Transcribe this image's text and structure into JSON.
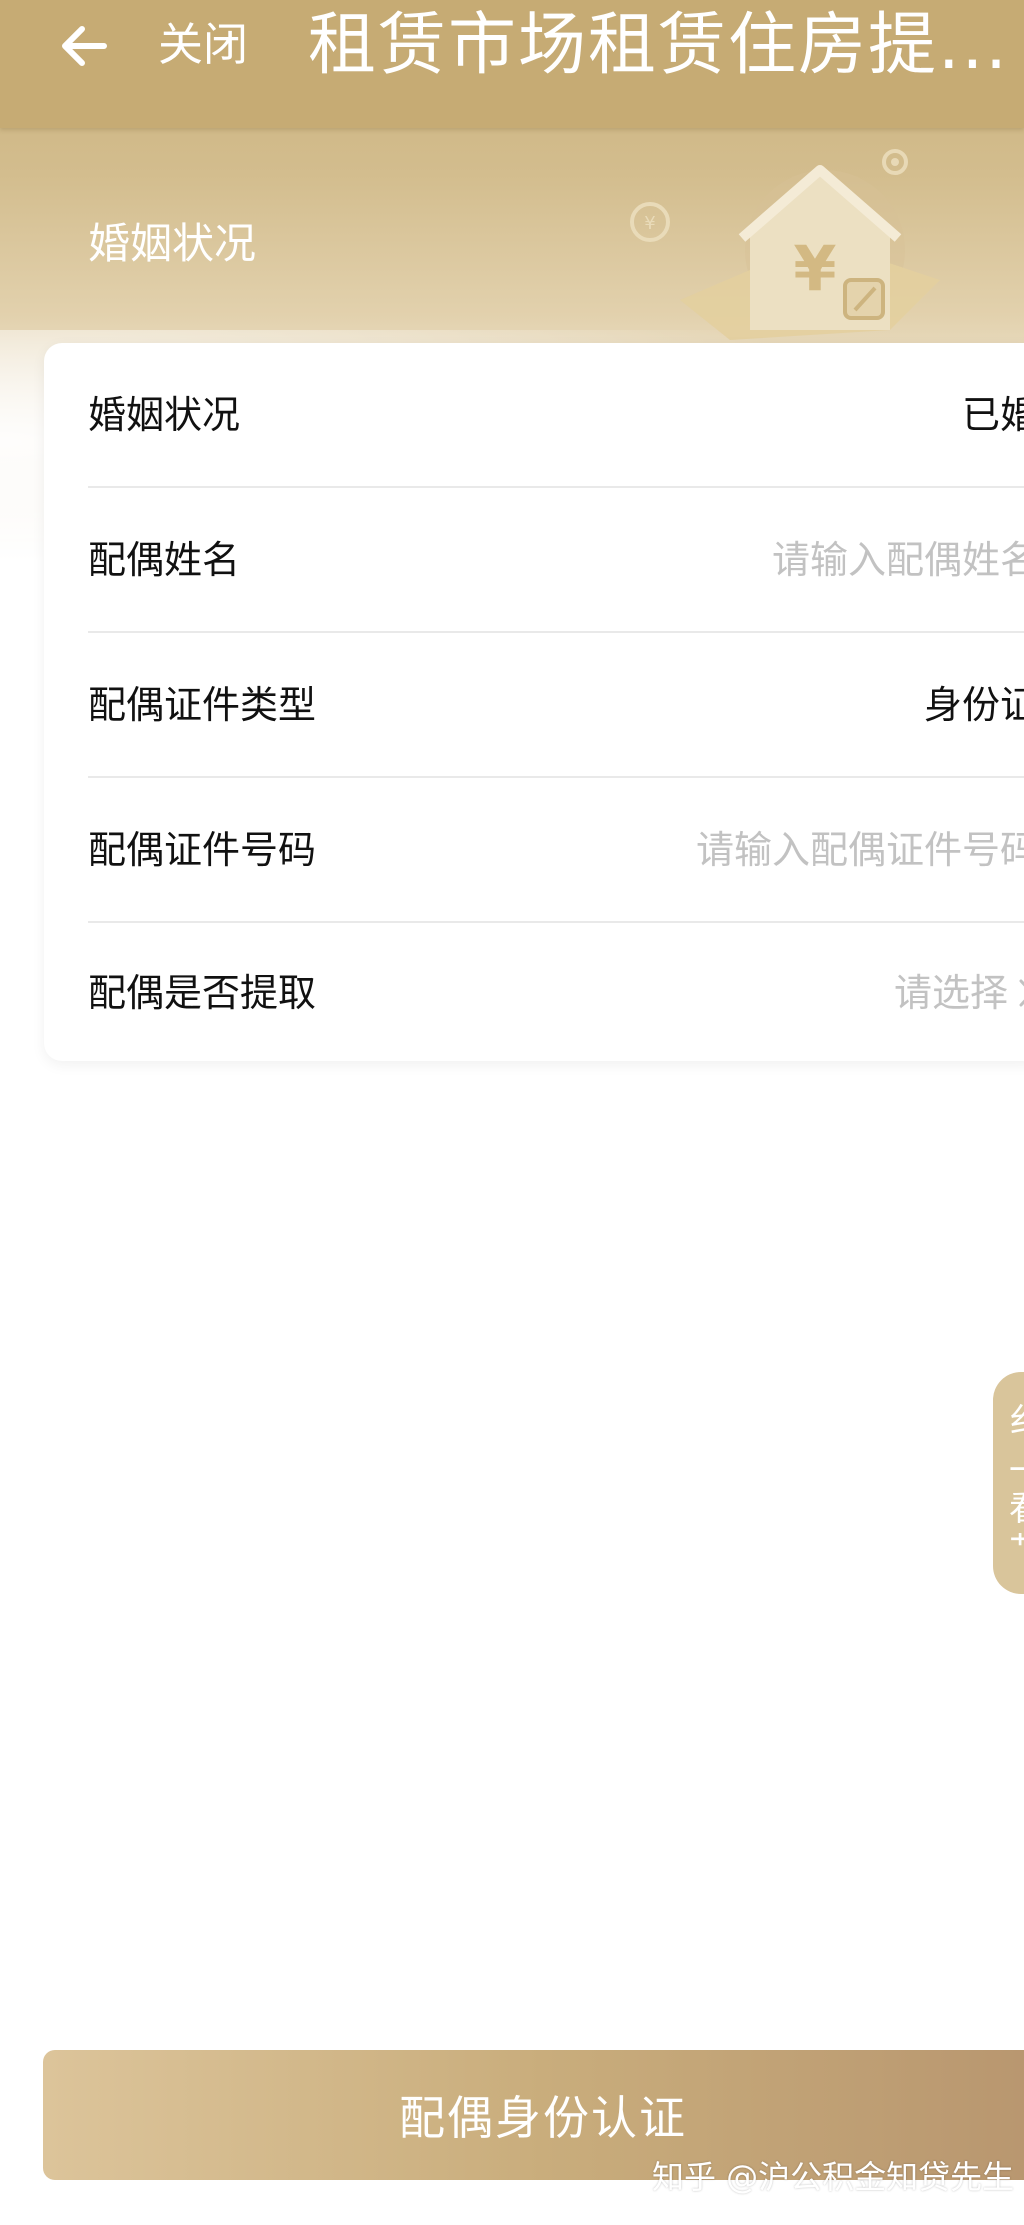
{
  "header": {
    "close_label": "关闭",
    "title": "租赁市场租赁住房提..."
  },
  "section": {
    "label": "婚姻状况"
  },
  "form": {
    "marital_status": {
      "label": "婚姻状况",
      "value": "已婚"
    },
    "spouse_name": {
      "label": "配偶姓名",
      "placeholder": "请输入配偶姓名"
    },
    "spouse_id_type": {
      "label": "配偶证件类型",
      "value": "身份证"
    },
    "spouse_id_number": {
      "label": "配偶证件号码",
      "placeholder": "请输入配偶证件号码"
    },
    "spouse_withdraw": {
      "label": "配偶是否提取",
      "placeholder": "请选择"
    }
  },
  "side_tab": {
    "chars": [
      "纟",
      "一",
      "看",
      "艹"
    ]
  },
  "footer": {
    "submit_label": "配偶身份认证",
    "watermark": "知乎 @沪公积金知贷先生"
  },
  "colors": {
    "header_gold": "#c6ab74",
    "placeholder_gray": "#c2c2c2",
    "button_gradient_start": "#dcc49a",
    "button_gradient_end": "#b8966f"
  },
  "icons": {
    "back": "arrow-left-icon",
    "chevron": "chevron-right-icon",
    "illustration": "house-yuan-icon"
  }
}
